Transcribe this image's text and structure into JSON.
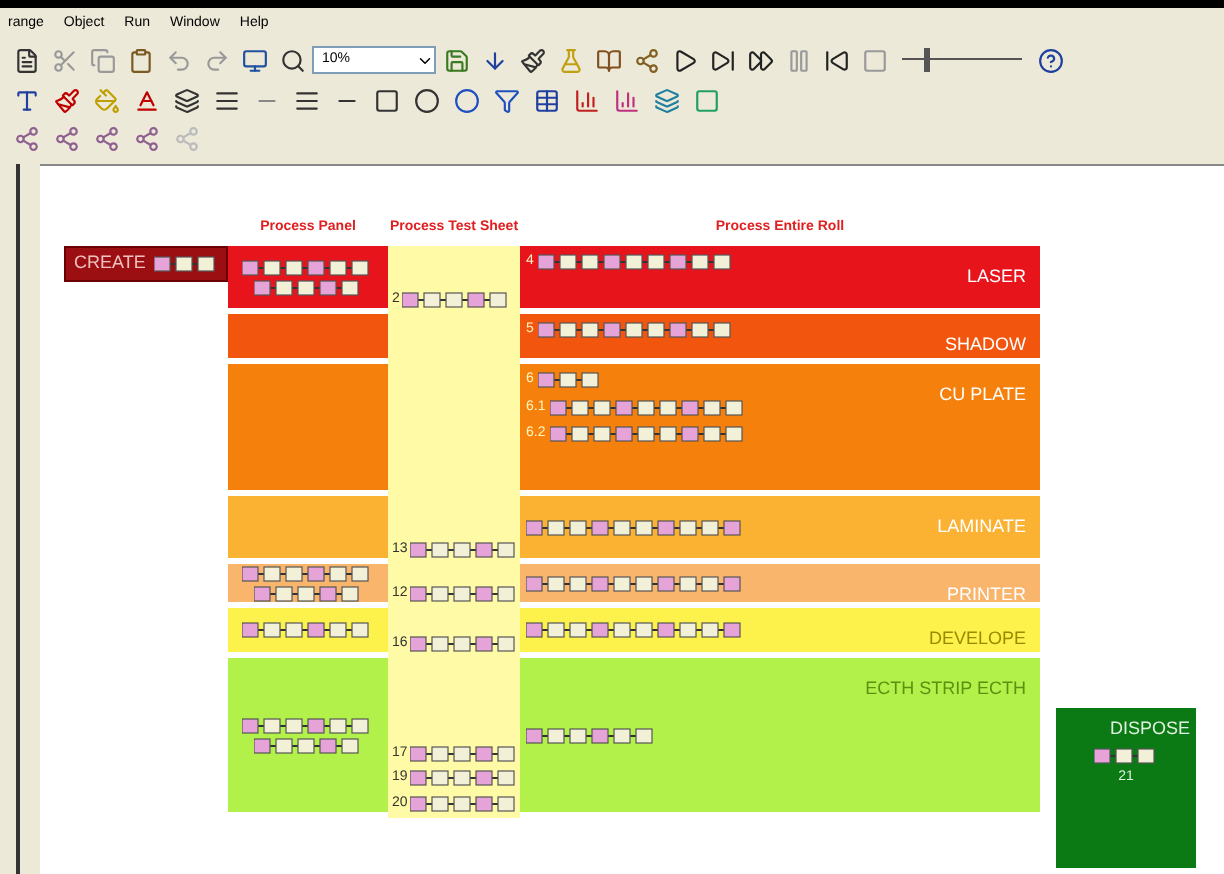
{
  "menu": [
    "range",
    "Object",
    "Run",
    "Window",
    "Help"
  ],
  "zoom_field": {
    "value": "10%"
  },
  "speed_slider": {
    "level": 0.18
  },
  "columns": [
    "Process Panel",
    "Process Test Sheet",
    "Process Entire Roll"
  ],
  "create_box": {
    "label": "CREATE"
  },
  "lanes": [
    {
      "label": "LASER",
      "color": "#e8141c",
      "test_steps": [
        "2"
      ],
      "roll_steps": [
        "4"
      ]
    },
    {
      "label": "SHADOW",
      "color": "#f2560e",
      "roll_steps": [
        "5"
      ]
    },
    {
      "label": "CU PLATE",
      "color": "#f5800c",
      "roll_steps": [
        "6",
        "6.1",
        "6.2"
      ]
    },
    {
      "label": "LAMINATE",
      "color": "#fbb132",
      "test_steps": [
        "13"
      ]
    },
    {
      "label": "PRINTER",
      "color": "#f9b56c",
      "test_steps": [
        "12"
      ]
    },
    {
      "label": "DEVELOPE",
      "color": "#fdf24c",
      "test_steps": [
        "16"
      ]
    },
    {
      "label": "ECTH STRIP ECTH",
      "color": "#b2f14a",
      "test_steps": [
        "17",
        "19",
        "20"
      ]
    }
  ],
  "dispose_box": {
    "label": "DISPOSE",
    "step": "21"
  }
}
